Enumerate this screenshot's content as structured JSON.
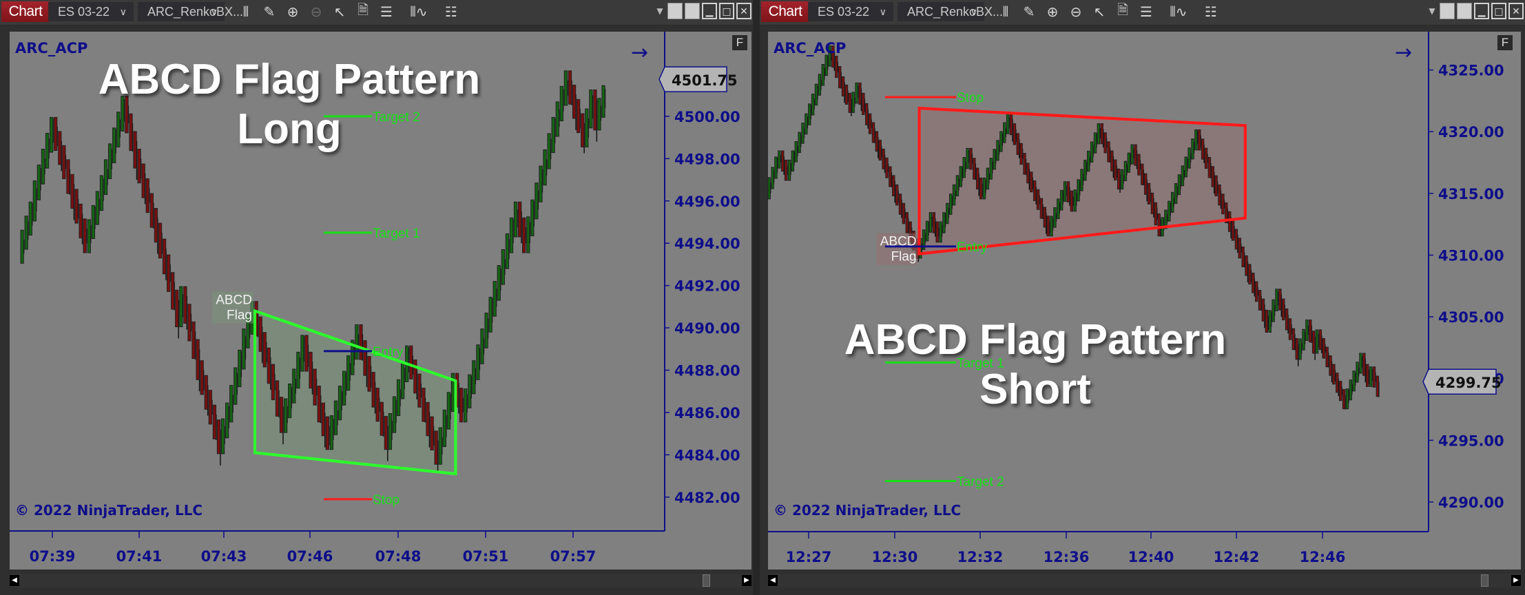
{
  "panels": [
    {
      "toolbar": {
        "tab_label": "Chart",
        "instrument": "ES 03-22",
        "chart_type": "ARC_RenkoBX...",
        "icons": [
          "bar-type-icon",
          "drawing-tool-icon",
          "zoom-in-icon",
          "zoom-out-icon",
          "pointer-icon",
          "data-box-icon",
          "properties-icon",
          "indicators-icon",
          "strategies-icon"
        ],
        "window_buttons": [
          "tile-icon",
          "tile-icon",
          "minimize-icon",
          "maximize-icon",
          "close-icon"
        ]
      },
      "indicator_label": "ARC_ACP",
      "overlay_title_line1": "ABCD Flag Pattern",
      "overlay_title_line2": "Long",
      "copyright": "© 2022 NinjaTrader, LLC",
      "f_button": "F",
      "current_price_label": "4501.75",
      "flag_label_line1": "ABCD",
      "flag_label_line2": "Flag"
    },
    {
      "toolbar": {
        "tab_label": "Chart",
        "instrument": "ES 03-22",
        "chart_type": "ARC_RenkoBX...",
        "icons": [
          "bar-type-icon",
          "drawing-tool-icon",
          "zoom-in-icon",
          "zoom-out-icon",
          "pointer-icon",
          "data-box-icon",
          "properties-icon",
          "indicators-icon",
          "strategies-icon"
        ],
        "window_buttons": [
          "tile-icon",
          "tile-icon",
          "minimize-icon",
          "maximize-icon",
          "close-icon"
        ]
      },
      "indicator_label": "ARC_ACP",
      "overlay_title_line1": "ABCD Flag Pattern",
      "overlay_title_line2": "Short",
      "copyright": "© 2022 NinjaTrader, LLC",
      "f_button": "F",
      "current_price_label": "4299.75",
      "flag_label_line1": "ABCD",
      "flag_label_line2": "Flag"
    }
  ],
  "colors": {
    "tab_red": "#a3232b",
    "axis_blue": "#0e0e8a",
    "plot_bg": "#808080",
    "up_bar": "#146414",
    "down_bar": "#7a1010",
    "level_green": "#16e016",
    "stop_red": "#ff1a1a",
    "entry_blue": "#0e0e8a",
    "flag_long": "#2dff2d",
    "flag_short": "#ff1a1a"
  },
  "chart_data": [
    {
      "type": "renko",
      "title": "ABCD Flag Pattern Long",
      "instrument": "ES 03-22",
      "y_ticks": [
        "4482.00",
        "4484.00",
        "4486.00",
        "4488.00",
        "4490.00",
        "4492.00",
        "4494.00",
        "4496.00",
        "4498.00",
        "4500.00"
      ],
      "y_tick_values": [
        4482,
        4484,
        4486,
        4488,
        4490,
        4492,
        4494,
        4496,
        4498,
        4500
      ],
      "ylim": [
        4480.4,
        4504
      ],
      "x_ticks": [
        "07:39",
        "07:41",
        "07:43",
        "07:46",
        "07:48",
        "07:51",
        "07:57"
      ],
      "current_price": 4501.75,
      "brick_size": 0.75,
      "price_path": [
        4493.5,
        4495.5,
        4496.5,
        4499.5,
        4497.5,
        4494.0,
        4496.0,
        4500.5,
        4498.0,
        4494.5,
        4493.0,
        4490.5,
        4491.5,
        4489.0,
        4488.0,
        4484.5,
        4486.0,
        4488.5,
        4489.5,
        4490.8,
        4488.6,
        4485.5,
        4487.6,
        4489.2,
        4486.0,
        4484.7,
        4487.5,
        4489.7,
        4486.7,
        4484.7,
        4488.7,
        4486.7,
        4484.0,
        4486.5,
        4487.4,
        4486.0,
        4488.0,
        4491.0,
        4494.0,
        4495.5,
        4494.0,
        4497.2,
        4499.5,
        4501.7,
        4499.0,
        4500.8,
        4499.8,
        4501.0
      ],
      "levels": [
        {
          "label": "Target 2",
          "price": 4500.0,
          "color": "#16e016"
        },
        {
          "label": "Target 1",
          "price": 4494.5,
          "color": "#16e016"
        },
        {
          "label": "Entry",
          "price": 4488.9,
          "color": "#0e0e8a"
        },
        {
          "label": "Stop",
          "price": 4481.9,
          "color": "#ff1a1a"
        }
      ],
      "flag": {
        "label": "ABCD Flag",
        "start_index": 19,
        "end_index": 34,
        "top_start": 4490.8,
        "top_end": 4487.5,
        "bottom_start": 4484.1,
        "bottom_end": 4483.1,
        "color": "#2dff2d"
      }
    },
    {
      "type": "renko",
      "title": "ABCD Flag Pattern Short",
      "instrument": "ES 03-22",
      "y_ticks": [
        "4290.00",
        "4295.00",
        "4300.00",
        "4305.00",
        "4310.00",
        "4315.00",
        "4320.00",
        "4325.00"
      ],
      "y_tick_values": [
        4290,
        4295,
        4300,
        4305,
        4310,
        4315,
        4320,
        4325
      ],
      "ylim": [
        4287.6,
        4328.1
      ],
      "x_ticks": [
        "12:27",
        "12:30",
        "12:32",
        "12:36",
        "12:40",
        "12:42",
        "12:46"
      ],
      "current_price": 4299.75,
      "brick_size": 0.75,
      "price_path": [
        4315.0,
        4317.5,
        4318.0,
        4316.5,
        4321.0,
        4325.0,
        4326.5,
        4324.0,
        4322.0,
        4323.5,
        4321.0,
        4316.0,
        4311.5,
        4310.2,
        4313.0,
        4311.5,
        4316.0,
        4318.2,
        4315.0,
        4317.4,
        4321.0,
        4317.0,
        4312.0,
        4315.5,
        4314.0,
        4316.5,
        4320.2,
        4315.8,
        4318.5,
        4313.8,
        4312.0,
        4313.2,
        4317.5,
        4319.7,
        4314.5,
        4309.5,
        4306.0,
        4304.2,
        4306.8,
        4302.0,
        4304.3,
        4302.5,
        4303.5,
        4300.0,
        4298.0,
        4301.6,
        4299.8,
        4300.5,
        4299.0
      ],
      "levels": [
        {
          "label": "Stop",
          "price": 4322.8,
          "color": "#ff1a1a"
        },
        {
          "label": "Entry",
          "price": 4310.7,
          "color": "#0e0e8a"
        },
        {
          "label": "Target 1",
          "price": 4301.3,
          "color": "#16e016"
        },
        {
          "label": "Target 2",
          "price": 4291.7,
          "color": "#16e016"
        }
      ],
      "flag": {
        "label": "ABCD Flag",
        "start_index": 13,
        "end_index": 35,
        "top_start": 4321.9,
        "top_end": 4320.5,
        "bottom_start": 4310.1,
        "bottom_end": 4313.0,
        "color": "#ff1a1a"
      }
    }
  ]
}
